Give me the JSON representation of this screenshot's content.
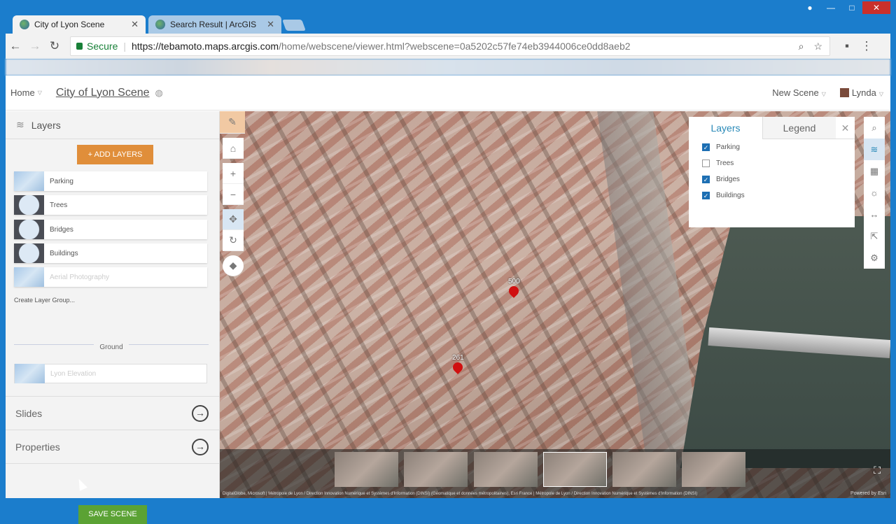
{
  "browser": {
    "tabs": [
      {
        "label": "City of Lyon Scene",
        "active": true
      },
      {
        "label": "Search Result | ArcGIS",
        "active": false
      }
    ],
    "secure_label": "Secure",
    "url_host": "https://tebamoto.maps.arcgis.com",
    "url_path": "/home/webscene/viewer.html?webscene=0a5202c57fe74eb3944006ce0dd8aeb2"
  },
  "header": {
    "home": "Home",
    "scene_title": "City of Lyon Scene",
    "new_scene": "New Scene",
    "user": "Lynda"
  },
  "sidebar": {
    "layers_title": "Layers",
    "add_layers": "+ ADD LAYERS",
    "layers": [
      "Parking",
      "Trees",
      "Bridges",
      "Buildings",
      "Aerial Photography"
    ],
    "create_group": "Create Layer Group...",
    "ground_label": "Ground",
    "ground_layer": "Lyon Elevation",
    "slides": "Slides",
    "properties": "Properties",
    "save": "SAVE SCENE"
  },
  "map": {
    "pins": [
      "500",
      "261"
    ],
    "panel": {
      "tab_layers": "Layers",
      "tab_legend": "Legend",
      "items": [
        {
          "label": "Parking",
          "checked": true
        },
        {
          "label": "Trees",
          "checked": false
        },
        {
          "label": "Bridges",
          "checked": true
        },
        {
          "label": "Buildings",
          "checked": true
        }
      ]
    },
    "attribution": "DigitalGlobe, Microsoft | Métropole de Lyon / Direction Innovation Numérique et Systèmes d'Information (DINSI) (Géomatique et données métropolitaines), Esri France | Métropole de Lyon / Direction Innovation Numérique et Systèmes d'Information (DINSI)",
    "powered_by": "Powered by Esri"
  },
  "colors": {
    "accent": "#2a8ab8",
    "add_button": "#e08e3a",
    "save_button": "#5ba234",
    "titlebar": "#1b7dcc"
  }
}
